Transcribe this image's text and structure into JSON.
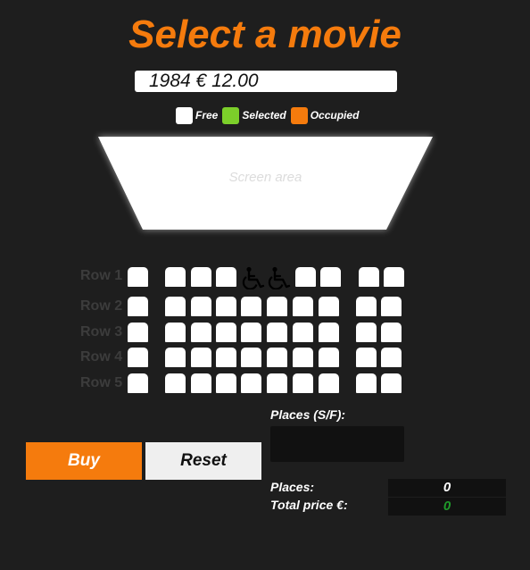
{
  "title": "Select a movie",
  "movie_select": {
    "value": "1984 € 12.00"
  },
  "legend": [
    {
      "label": "Free",
      "color": "#ffffff"
    },
    {
      "label": "Selected",
      "color": "#7ccf2a"
    },
    {
      "label": "Occupied",
      "color": "#f57b0d"
    }
  ],
  "screen": {
    "label": "Screen area"
  },
  "rows": [
    "Row 1",
    "Row 2",
    "Row 3",
    "Row 4",
    "Row 5"
  ],
  "wheelchair_icon": "wheelchair-icon",
  "places_sf": {
    "label": "Places (S/F):",
    "value": ""
  },
  "buttons": {
    "buy": "Buy",
    "reset": "Reset"
  },
  "summary": {
    "places_label": "Places:",
    "places_value": "0",
    "total_label": "Total price €:",
    "total_value": "0"
  },
  "colors": {
    "accent": "#f57b0d",
    "free": "#ffffff",
    "total_value": "#1f9a2a"
  }
}
